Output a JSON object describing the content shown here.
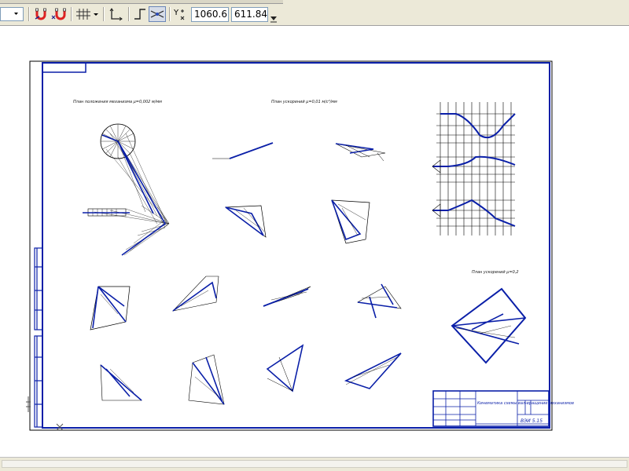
{
  "toolbar": {
    "coord_label": "Y",
    "coord_x": "1060.6",
    "coord_y": "611.84"
  },
  "drawing": {
    "caption_left": "План положения механизма μ=0,002 м/мм",
    "caption_mid": "План ускорений μ=0,01 м/с²/мм",
    "caption_right": "План ускорений μ=0,2",
    "title_block_text": "Кинематика схемы вал-вращение механизмов",
    "title_block_code": "ВЭИ 5.15"
  },
  "colors": {
    "frame": "#0a1fa8",
    "ink": "#000000",
    "toolbar_bg": "#ece9d8"
  },
  "icons": [
    "magnet-icon",
    "magnet-off-icon",
    "grid-icon",
    "axes-icon",
    "ortho-icon",
    "snap-icon",
    "coord-icon"
  ]
}
